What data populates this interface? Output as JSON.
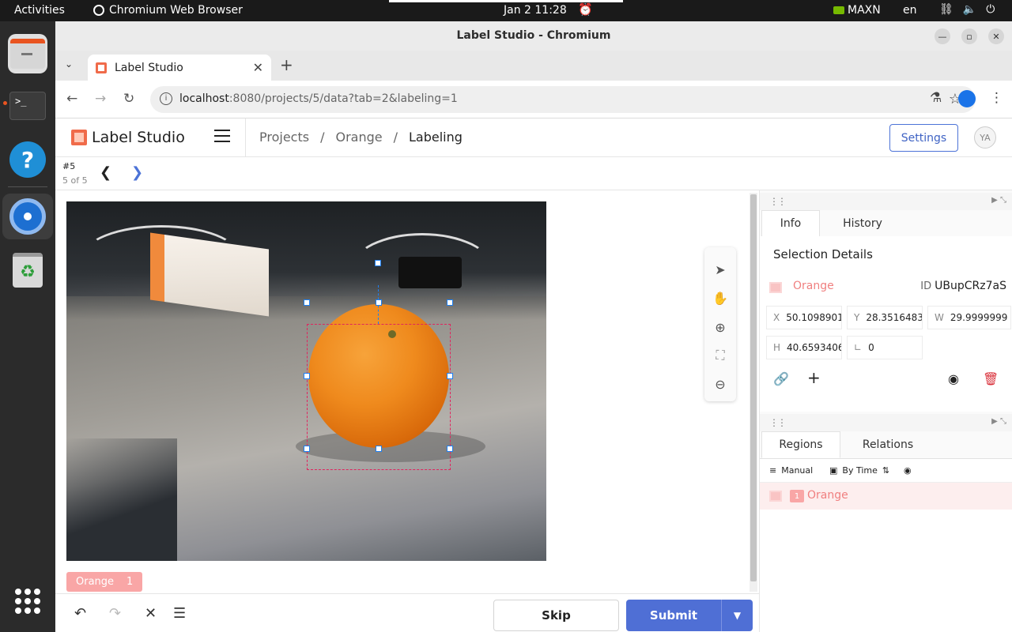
{
  "os": {
    "activities": "Activities",
    "app_name": "Chromium Web Browser",
    "clock": "Jan 2  11:28",
    "nvidia_mode": "MAXN",
    "language": "en"
  },
  "window": {
    "title": "Label Studio - Chromium"
  },
  "browser": {
    "tab_title": "Label Studio",
    "url_host": "localhost",
    "url_rest": ":8080/projects/5/data?tab=2&labeling=1"
  },
  "app": {
    "logo_text": "Label Studio",
    "breadcrumb": [
      "Projects",
      "Orange",
      "Labeling"
    ],
    "breadcrumb_sep": "/",
    "settings_label": "Settings",
    "avatar_initials": "YA"
  },
  "task": {
    "id_label": "#5",
    "count_label": "5 of 5"
  },
  "labels": {
    "chip_name": "Orange",
    "chip_count": "1"
  },
  "actions": {
    "skip_label": "Skip",
    "submit_label": "Submit"
  },
  "info_panel": {
    "tabs": [
      "Info",
      "History"
    ],
    "title": "Selection Details",
    "region_label": "Orange",
    "id_label": "ID",
    "region_id": "UBupCRz7aS",
    "fields": [
      {
        "label": "X",
        "value": "50.1098901"
      },
      {
        "label": "Y",
        "value": "28.3516483"
      },
      {
        "label": "W",
        "value": "29.9999999"
      },
      {
        "label": "H",
        "value": "40.6593406"
      },
      {
        "label": "∟",
        "value": "0"
      }
    ]
  },
  "regions_panel": {
    "tabs": [
      "Regions",
      "Relations"
    ],
    "sort_manual": "Manual",
    "sort_time": "By Time",
    "items": [
      {
        "index": "1",
        "label": "Orange"
      }
    ]
  },
  "colors": {
    "accent": "#4f6fd5",
    "label_orange": "#f9a6a6",
    "bbox_stroke": "#e0245e",
    "handle_stroke": "#1e7ff1"
  }
}
